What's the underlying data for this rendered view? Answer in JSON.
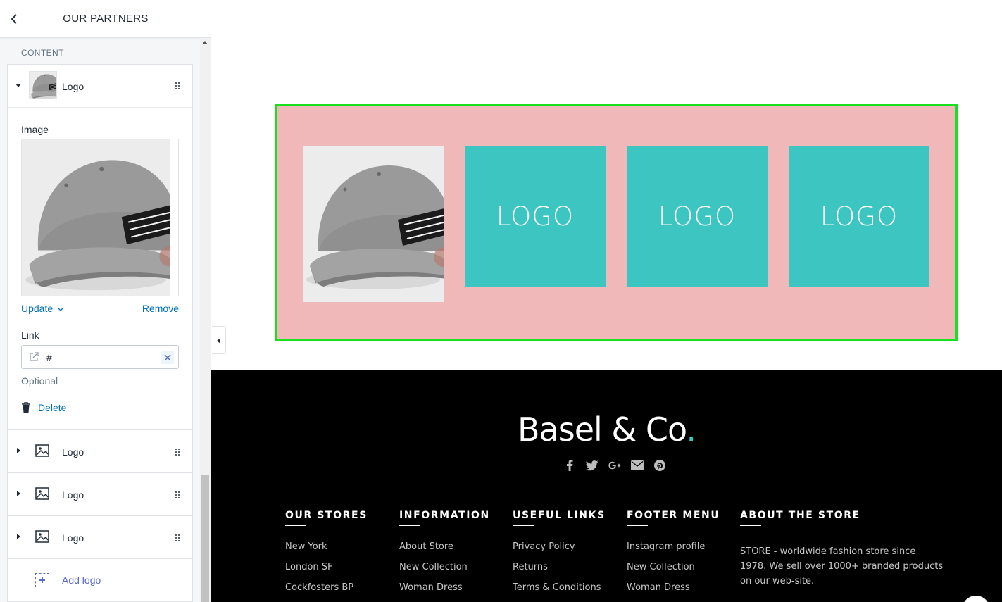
{
  "sidebar": {
    "title": "OUR PARTNERS",
    "section_label": "CONTENT",
    "expanded_block": {
      "label": "Logo",
      "image_label": "Image",
      "update_label": "Update",
      "remove_label": "Remove",
      "link_label": "Link",
      "link_value": "#",
      "optional_label": "Optional",
      "delete_label": "Delete"
    },
    "collapsed_blocks": [
      {
        "label": "Logo"
      },
      {
        "label": "Logo"
      },
      {
        "label": "Logo"
      }
    ],
    "add_label": "Add logo"
  },
  "preview": {
    "partners": {
      "background_color": "#f0b8b9",
      "border_color": "#19e01f",
      "tile_color": "#3cc5c1",
      "logos": [
        "LOGO",
        "LOGO",
        "LOGO"
      ]
    },
    "footer": {
      "brand": "Basel & Co",
      "brand_dot": ".",
      "social_icons": [
        "facebook-icon",
        "twitter-icon",
        "google-plus-icon",
        "email-icon",
        "pinterest-icon"
      ],
      "columns": [
        {
          "title": "OUR STORES",
          "links": [
            "New York",
            "London SF",
            "Cockfosters BP"
          ]
        },
        {
          "title": "INFORMATION",
          "links": [
            "About Store",
            "New Collection",
            "Woman Dress"
          ]
        },
        {
          "title": "USEFUL LINKS",
          "links": [
            "Privacy Policy",
            "Returns",
            "Terms & Conditions"
          ]
        },
        {
          "title": "FOOTER MENU",
          "links": [
            "Instagram profile",
            "New Collection",
            "Woman Dress"
          ]
        }
      ],
      "about": {
        "title": "ABOUT THE STORE",
        "text": "STORE - worldwide fashion store since 1978. We sell over 1000+ branded products on our web-site."
      }
    }
  }
}
